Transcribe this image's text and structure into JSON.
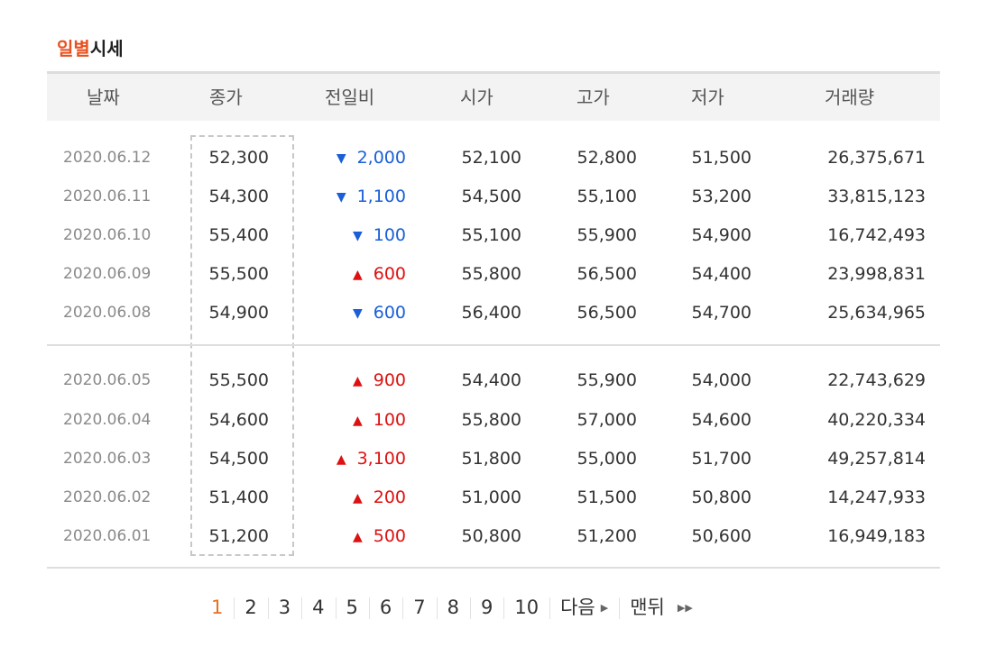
{
  "title": {
    "accent": "일별",
    "rest": "시세"
  },
  "columns": [
    "날짜",
    "종가",
    "전일비",
    "시가",
    "고가",
    "저가",
    "거래량"
  ],
  "rows": [
    {
      "date": "2020.06.12",
      "close": "52,300",
      "dir": "down",
      "change": "2,000",
      "open": "52,100",
      "high": "52,800",
      "low": "51,500",
      "volume": "26,375,671"
    },
    {
      "date": "2020.06.11",
      "close": "54,300",
      "dir": "down",
      "change": "1,100",
      "open": "54,500",
      "high": "55,100",
      "low": "53,200",
      "volume": "33,815,123"
    },
    {
      "date": "2020.06.10",
      "close": "55,400",
      "dir": "down",
      "change": "100",
      "open": "55,100",
      "high": "55,900",
      "low": "54,900",
      "volume": "16,742,493"
    },
    {
      "date": "2020.06.09",
      "close": "55,500",
      "dir": "up",
      "change": "600",
      "open": "55,800",
      "high": "56,500",
      "low": "54,400",
      "volume": "23,998,831"
    },
    {
      "date": "2020.06.08",
      "close": "54,900",
      "dir": "down",
      "change": "600",
      "open": "56,400",
      "high": "56,500",
      "low": "54,700",
      "volume": "25,634,965"
    },
    {
      "date": "2020.06.05",
      "close": "55,500",
      "dir": "up",
      "change": "900",
      "open": "54,400",
      "high": "55,900",
      "low": "54,000",
      "volume": "22,743,629"
    },
    {
      "date": "2020.06.04",
      "close": "54,600",
      "dir": "up",
      "change": "100",
      "open": "55,800",
      "high": "57,000",
      "low": "54,600",
      "volume": "40,220,334"
    },
    {
      "date": "2020.06.03",
      "close": "54,500",
      "dir": "up",
      "change": "3,100",
      "open": "51,800",
      "high": "55,000",
      "low": "51,700",
      "volume": "49,257,814"
    },
    {
      "date": "2020.06.02",
      "close": "51,400",
      "dir": "up",
      "change": "200",
      "open": "51,000",
      "high": "51,500",
      "low": "50,800",
      "volume": "14,247,933"
    },
    {
      "date": "2020.06.01",
      "close": "51,200",
      "dir": "up",
      "change": "500",
      "open": "50,800",
      "high": "51,200",
      "low": "50,600",
      "volume": "16,949,183"
    }
  ],
  "arrows": {
    "up": "▲",
    "down": "▼"
  },
  "colors": {
    "accent": "#e8501f",
    "up": "#dd1111",
    "down": "#1a5fd8"
  },
  "pagination": {
    "pages": [
      "1",
      "2",
      "3",
      "4",
      "5",
      "6",
      "7",
      "8",
      "9",
      "10"
    ],
    "current": "1",
    "next_label": "다음",
    "last_label": "맨뒤"
  }
}
